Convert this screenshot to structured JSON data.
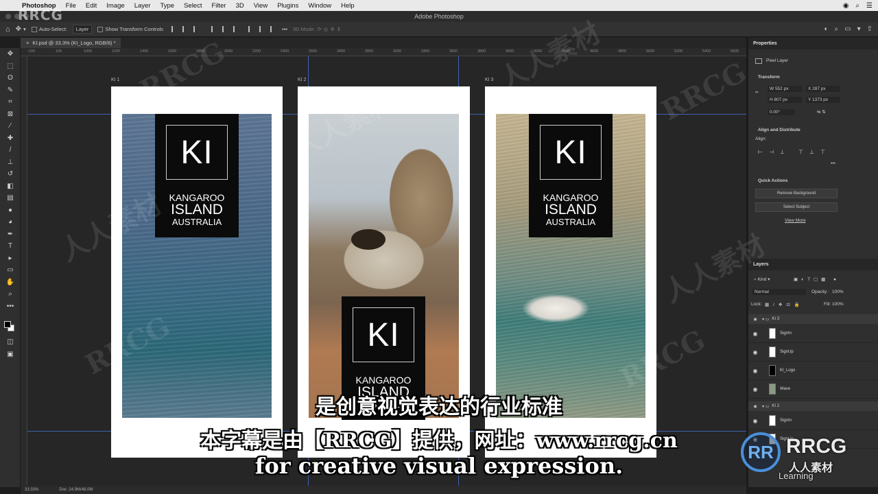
{
  "menubar": {
    "app": "Photoshop",
    "items": [
      "File",
      "Edit",
      "Image",
      "Layer",
      "Type",
      "Select",
      "Filter",
      "3D",
      "View",
      "Plugins",
      "Window",
      "Help"
    ]
  },
  "window_title": "Adobe Photoshop",
  "options": {
    "auto_select_label": "Auto-Select:",
    "auto_select_value": "Layer",
    "transform_label": "Show Transform Controls",
    "mode_3d": "3D Mode:"
  },
  "document_tab": "KI.psd @ 33.3% (KI_Logo, RGB/8) *",
  "ruler_ticks": [
    "-100",
    "100",
    "1000",
    "1200",
    "1400",
    "1600",
    "1800",
    "2000",
    "2200",
    "2400",
    "2600",
    "2800",
    "3000",
    "3200",
    "3400",
    "3600",
    "3800",
    "4000",
    "4200",
    "4400",
    "4600",
    "4800",
    "5000",
    "5200",
    "5400",
    "5600"
  ],
  "artboards": [
    {
      "label": "KI 1"
    },
    {
      "label": "KI 2"
    },
    {
      "label": "KI 3"
    }
  ],
  "logo": {
    "mark": "KI",
    "line1": "KANGAROO",
    "line2": "ISLAND",
    "line3": "AUSTRALIA"
  },
  "properties": {
    "tab": "Properties",
    "layer_type": "Pixel Layer",
    "transform_title": "Transform",
    "w": "W 552 px",
    "x": "X 287 px",
    "h": "H 807 px",
    "y": "Y 1373 px",
    "angle": "0.00°",
    "align_title": "Align and Distribute",
    "align_label": "Align:",
    "quick_title": "Quick Actions",
    "remove_bg": "Remove Background",
    "select_subject": "Select Subject",
    "view_more": "View More"
  },
  "layers": {
    "tab": "Layers",
    "kind": "Kind",
    "blend": "Normal",
    "opacity_label": "Opacity:",
    "opacity_value": "100%",
    "lock_label": "Lock:",
    "fill_label": "Fill:",
    "fill_value": "100%",
    "group_ki3": "KI 3",
    "items_ki3": [
      "SignIn",
      "SignUp",
      "KI_Logo",
      "Wave"
    ],
    "group_ki2": "KI 2",
    "items_ki2": [
      "SignIn",
      "SignUp"
    ]
  },
  "status": {
    "zoom": "33.33%",
    "doc": "Doc: 24.9M/48.0M"
  },
  "subtitles": {
    "line1": "是创意视觉表达的行业标准",
    "line2": "本字幕是由【RRCG】提供，网址：www.rrcg.cn",
    "line3": "for creative visual expression."
  },
  "watermarks": {
    "top_left": "RRCG",
    "brand_circle": "RR",
    "brand_name": "RRCG",
    "brand_cn": "人人素材",
    "linked": "Learning",
    "repeat_cn": "人人素材"
  }
}
